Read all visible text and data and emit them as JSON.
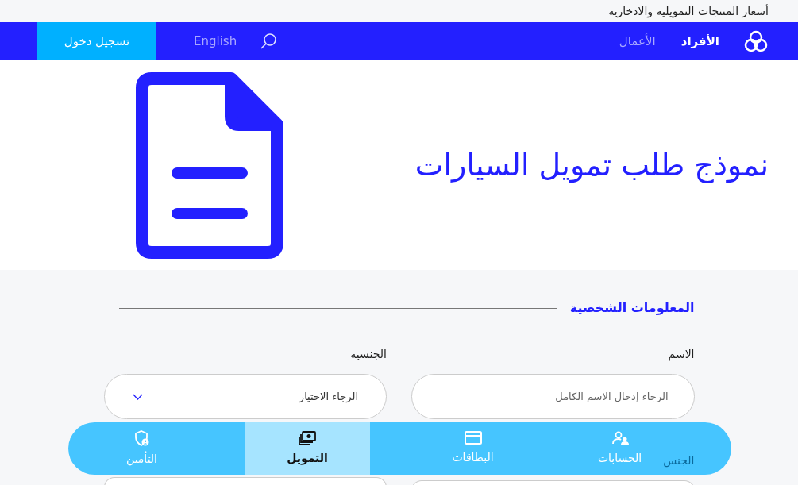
{
  "top_bar": {
    "link": "أسعار المنتجات التمويلية والادخارية"
  },
  "nav": {
    "items": [
      {
        "label": "الأفراد",
        "selected": true
      },
      {
        "label": "الأعمال",
        "selected": false
      }
    ],
    "language": "English",
    "login": "تسجيل دخول"
  },
  "hero": {
    "title": "نموذج طلب تمويل السيارات"
  },
  "form": {
    "section_title": "المعلومات الشخصية",
    "fields": [
      {
        "kind": "text",
        "label": "الاسم",
        "placeholder": "الرجاء إدخال الاسم الكامل"
      },
      {
        "kind": "select",
        "label": "الجنسيه",
        "value": "الرجاء الاختيار"
      },
      {
        "kind": "text",
        "label": "الجنس"
      },
      {
        "kind": "text"
      }
    ]
  },
  "bottom_nav": [
    {
      "kind": "accounts",
      "label": "الحسابات",
      "selected": false
    },
    {
      "kind": "cards",
      "label": "البطاقات",
      "selected": false
    },
    {
      "kind": "financing",
      "label": "التمويل",
      "selected": true
    },
    {
      "kind": "insurance",
      "label": "التأمين",
      "selected": false
    }
  ]
}
